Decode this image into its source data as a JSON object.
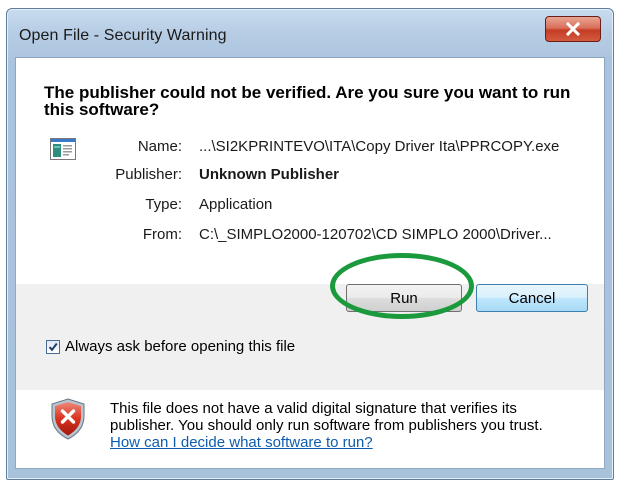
{
  "window": {
    "title": "Open File - Security Warning"
  },
  "headline": "The publisher could not be verified.  Are you sure you want to run this software?",
  "details": [
    {
      "label": "Name:",
      "value": "...\\SI2KPRINTEVO\\ITA\\Copy Driver Ita\\PPRCOPY.exe",
      "bold": false
    },
    {
      "label": "Publisher:",
      "value": "Unknown Publisher",
      "bold": true
    },
    {
      "label": "Type:",
      "value": "Application",
      "bold": false
    },
    {
      "label": "From:",
      "value": "C:\\_SIMPLO2000-120702\\CD SIMPLO 2000\\Driver...",
      "bold": false
    }
  ],
  "buttons": {
    "run": "Run",
    "cancel": "Cancel"
  },
  "checkbox": {
    "label": "Always ask before opening this file",
    "checked": true
  },
  "warning": {
    "text": "This file does not have a valid digital signature that verifies its publisher.  You should only run software from publishers you trust.",
    "link": "How can I decide what software to run?"
  },
  "icons": {
    "close": "close-icon",
    "app": "application-icon",
    "shield": "shield-error-icon",
    "check": "checkmark-icon"
  },
  "colors": {
    "highlight": "#1a9a3c",
    "link": "#0d5cb0",
    "close_button": "#c43d24"
  }
}
